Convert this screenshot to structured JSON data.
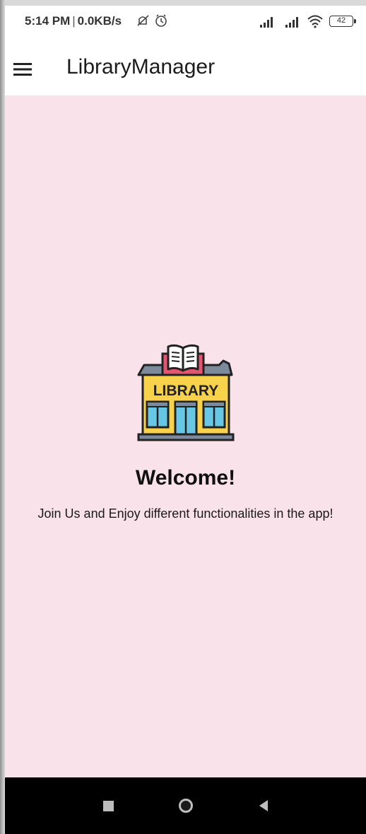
{
  "status_bar": {
    "time": "5:14 PM",
    "speed": "0.0KB/s",
    "battery_level": "42",
    "icons": [
      "mute-icon",
      "alarm-icon",
      "signal-icon",
      "signal-icon",
      "wifi-icon",
      "battery-icon"
    ]
  },
  "app_bar": {
    "title": "LibraryManager",
    "menu_icon": "hamburger-menu-icon"
  },
  "main": {
    "image_icon": "library-building-icon",
    "image_text": "LIBRARY",
    "welcome": "Welcome!",
    "subtitle": "Join Us and Enjoy different functionalities in the app!",
    "background_color": "#f9e2ea"
  },
  "nav_bar": {
    "buttons": [
      "recents-icon",
      "home-icon",
      "back-icon"
    ]
  }
}
